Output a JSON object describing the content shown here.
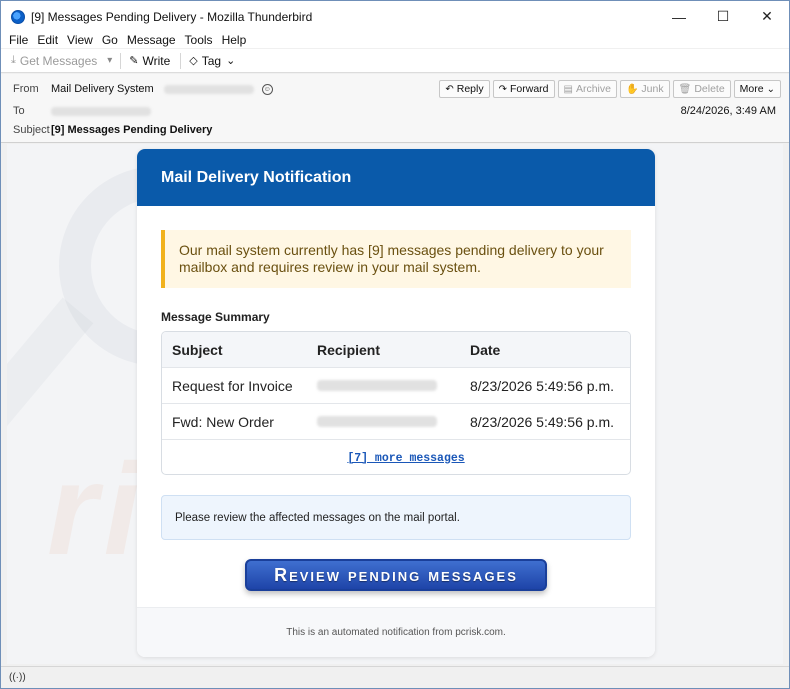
{
  "window": {
    "title": "[9] Messages Pending Delivery - Mozilla Thunderbird",
    "minimize": "—",
    "maximize": "☐",
    "close": "✕"
  },
  "menu": [
    {
      "label": "File"
    },
    {
      "label": "Edit"
    },
    {
      "label": "View"
    },
    {
      "label": "Go"
    },
    {
      "label": "Message"
    },
    {
      "label": "Tools"
    },
    {
      "label": "Help"
    }
  ],
  "toolbar": {
    "get_messages": "Get Messages",
    "write": "Write",
    "tag": "Tag"
  },
  "header": {
    "from_label": "From",
    "from_name": "Mail Delivery System",
    "to_label": "To",
    "subject_label": "Subject",
    "subject": "[9] Messages Pending Delivery",
    "date": "8/24/2026, 3:49 AM",
    "actions": {
      "reply": "Reply",
      "forward": "Forward",
      "archive": "Archive",
      "junk": "Junk",
      "delete": "Delete",
      "more": "More"
    }
  },
  "email": {
    "heading": "Mail Delivery Notification",
    "alert": "Our mail system currently has [9] messages pending delivery to your mailbox and requires review in your mail system.",
    "summary_label": "Message Summary",
    "table": {
      "columns": [
        "Subject",
        "Recipient",
        "Date"
      ],
      "rows": [
        {
          "subject": "Request for Invoice",
          "date": "8/23/2026 5:49:56 p.m."
        },
        {
          "subject": "Fwd: New Order",
          "date": "8/23/2026 5:49:56 p.m."
        }
      ],
      "more_link": "[7] more messages"
    },
    "info": "Please review the affected messages on the mail portal.",
    "cta": "Review pending messages",
    "footer": "This is an automated notification from pcrisk.com."
  }
}
